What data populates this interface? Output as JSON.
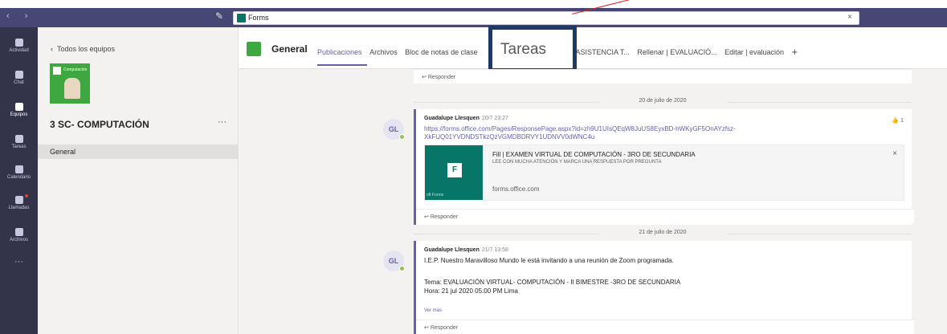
{
  "titlebar": {
    "app_tag": "Forms",
    "close": "×",
    "nav": "‹ ›"
  },
  "rail": [
    {
      "label": "Actividad",
      "active": false
    },
    {
      "label": "Chat",
      "active": false
    },
    {
      "label": "Equipos",
      "active": true
    },
    {
      "label": "Tareas",
      "active": false
    },
    {
      "label": "Calendario",
      "active": false
    },
    {
      "label": "Llamadas",
      "active": false
    },
    {
      "label": "Archivos",
      "active": false
    },
    {
      "label": "···",
      "active": false
    }
  ],
  "teampanel": {
    "back_label": "Todos los equipos",
    "team_name": "3 SC- COMPUTACIÓN",
    "more": "···",
    "channel": "General",
    "logo_word": "Computación"
  },
  "channel": {
    "name": "General",
    "tabs": [
      "Publicaciones",
      "Archivos",
      "Bloc de notas de clase",
      "| ASISTENCIA T...",
      "Rellenar | EVALUACIÓ...",
      "Editar | evaluación"
    ],
    "plus": "+"
  },
  "callout": {
    "text": "Tareas"
  },
  "feed": {
    "reply_label": "Responder",
    "date1": "20 de julio de 2020",
    "date2": "21 de julio de 2020",
    "post1": {
      "initials": "GL",
      "author": "Guadalupe Llesquen",
      "time": "20/7 23:27",
      "link": "https://forms.office.com/Pages/ResponsePage.aspx?id=zh9U1UIsQEqW8JuUS8EyxBD-hWKyGF5OnAYzfsz-XkFUQ01YVDNDSTkzQzVGMDBDRVY1UDNVV0dWNC4u",
      "likes": "1",
      "card_title": "Fill | EXAMEN VIRTUAL DE COMPUTACIÓN - 3RO DE SECUNDARIA",
      "card_sub": "LEE CON MUCHA ATENCIÓN Y MARCA UNA RESPUESTA POR PREGUNTA",
      "card_domain": "forms.office.com",
      "card_caption": "oft Forms"
    },
    "post2": {
      "initials": "GL",
      "author": "Guadalupe Llesquen",
      "time": "21/7 13:58",
      "line1": "I.E.P. Nuestro Maravilloso Mundo le está invitando a una reunión de Zoom programada.",
      "line2": "Tema: EVALUACIÓN VIRTUAL- COMPUTACIÓN -  II BIMESTRE -3RO DE SECUNDARIA",
      "line3": "Hora: 21 jul 2020 05:00 PM Lima",
      "more": "Ver más"
    }
  }
}
